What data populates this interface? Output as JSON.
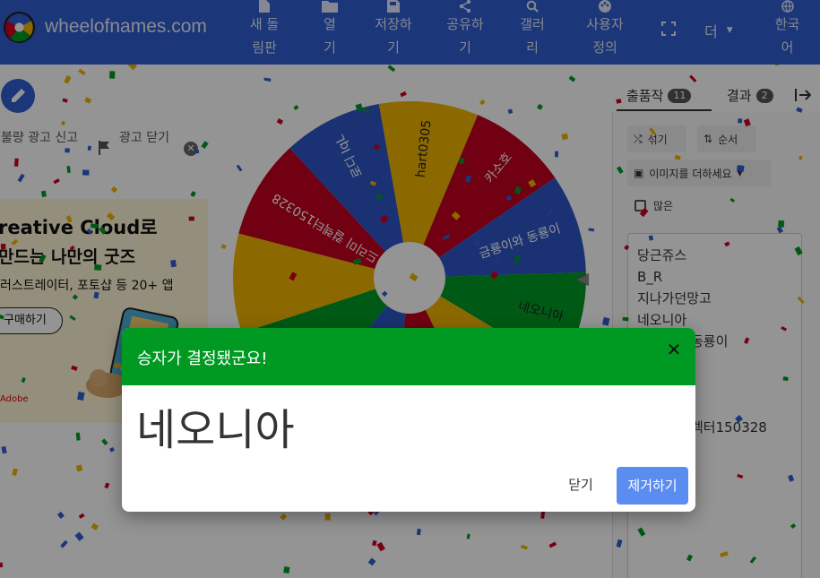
{
  "brand": {
    "name": "wheelofnames.com"
  },
  "nav": {
    "new": "새 돌림판",
    "open": "열기",
    "save": "저장하기",
    "share": "공유하기",
    "gallery": "갤러리",
    "customize": "사용자 정의",
    "more": "더",
    "language": "한국어"
  },
  "adbar": {
    "report": "불량 광고 신고",
    "close": "광고 닫기"
  },
  "ad": {
    "line1": "reative Cloud로",
    "line2": "만드는 나만의 굿즈",
    "line3": "러스트레이터, 포토샵 등 20+ 앱",
    "buy": "구매하기",
    "brand": "Adobe"
  },
  "wheel": {
    "labels": [
      "hart0305",
      "카소호",
      "금룡이와 동룡이",
      "네오니아",
      "시크리",
      "드리미 컬렉터150328",
      "로디 IqL"
    ]
  },
  "panel": {
    "tab_entries": "출품작",
    "tab_entries_count": "11",
    "tab_results": "결과",
    "tab_results_count": "2",
    "shuffle": "섞기",
    "sort": "순서",
    "add_image": "이미지를 더하세요",
    "advanced": "많은",
    "entries": [
      "당근쥬스",
      "B_R",
      "지나가던망고",
      "네오니아",
      "금룡이와 동룡이",
      "",
      "",
      "",
      "드리미 컬렉터150328"
    ]
  },
  "dialog": {
    "title": "승자가 결정됐군요!",
    "winner": "네오니아",
    "close": "닫기",
    "remove": "제거하기"
  },
  "colors": {
    "topbar": "#2f5dd0",
    "green": "#009a23",
    "red": "#c1001f",
    "blue": "#2e57c6",
    "yellow": "#efb300",
    "remove_button": "#5b8cf0"
  }
}
